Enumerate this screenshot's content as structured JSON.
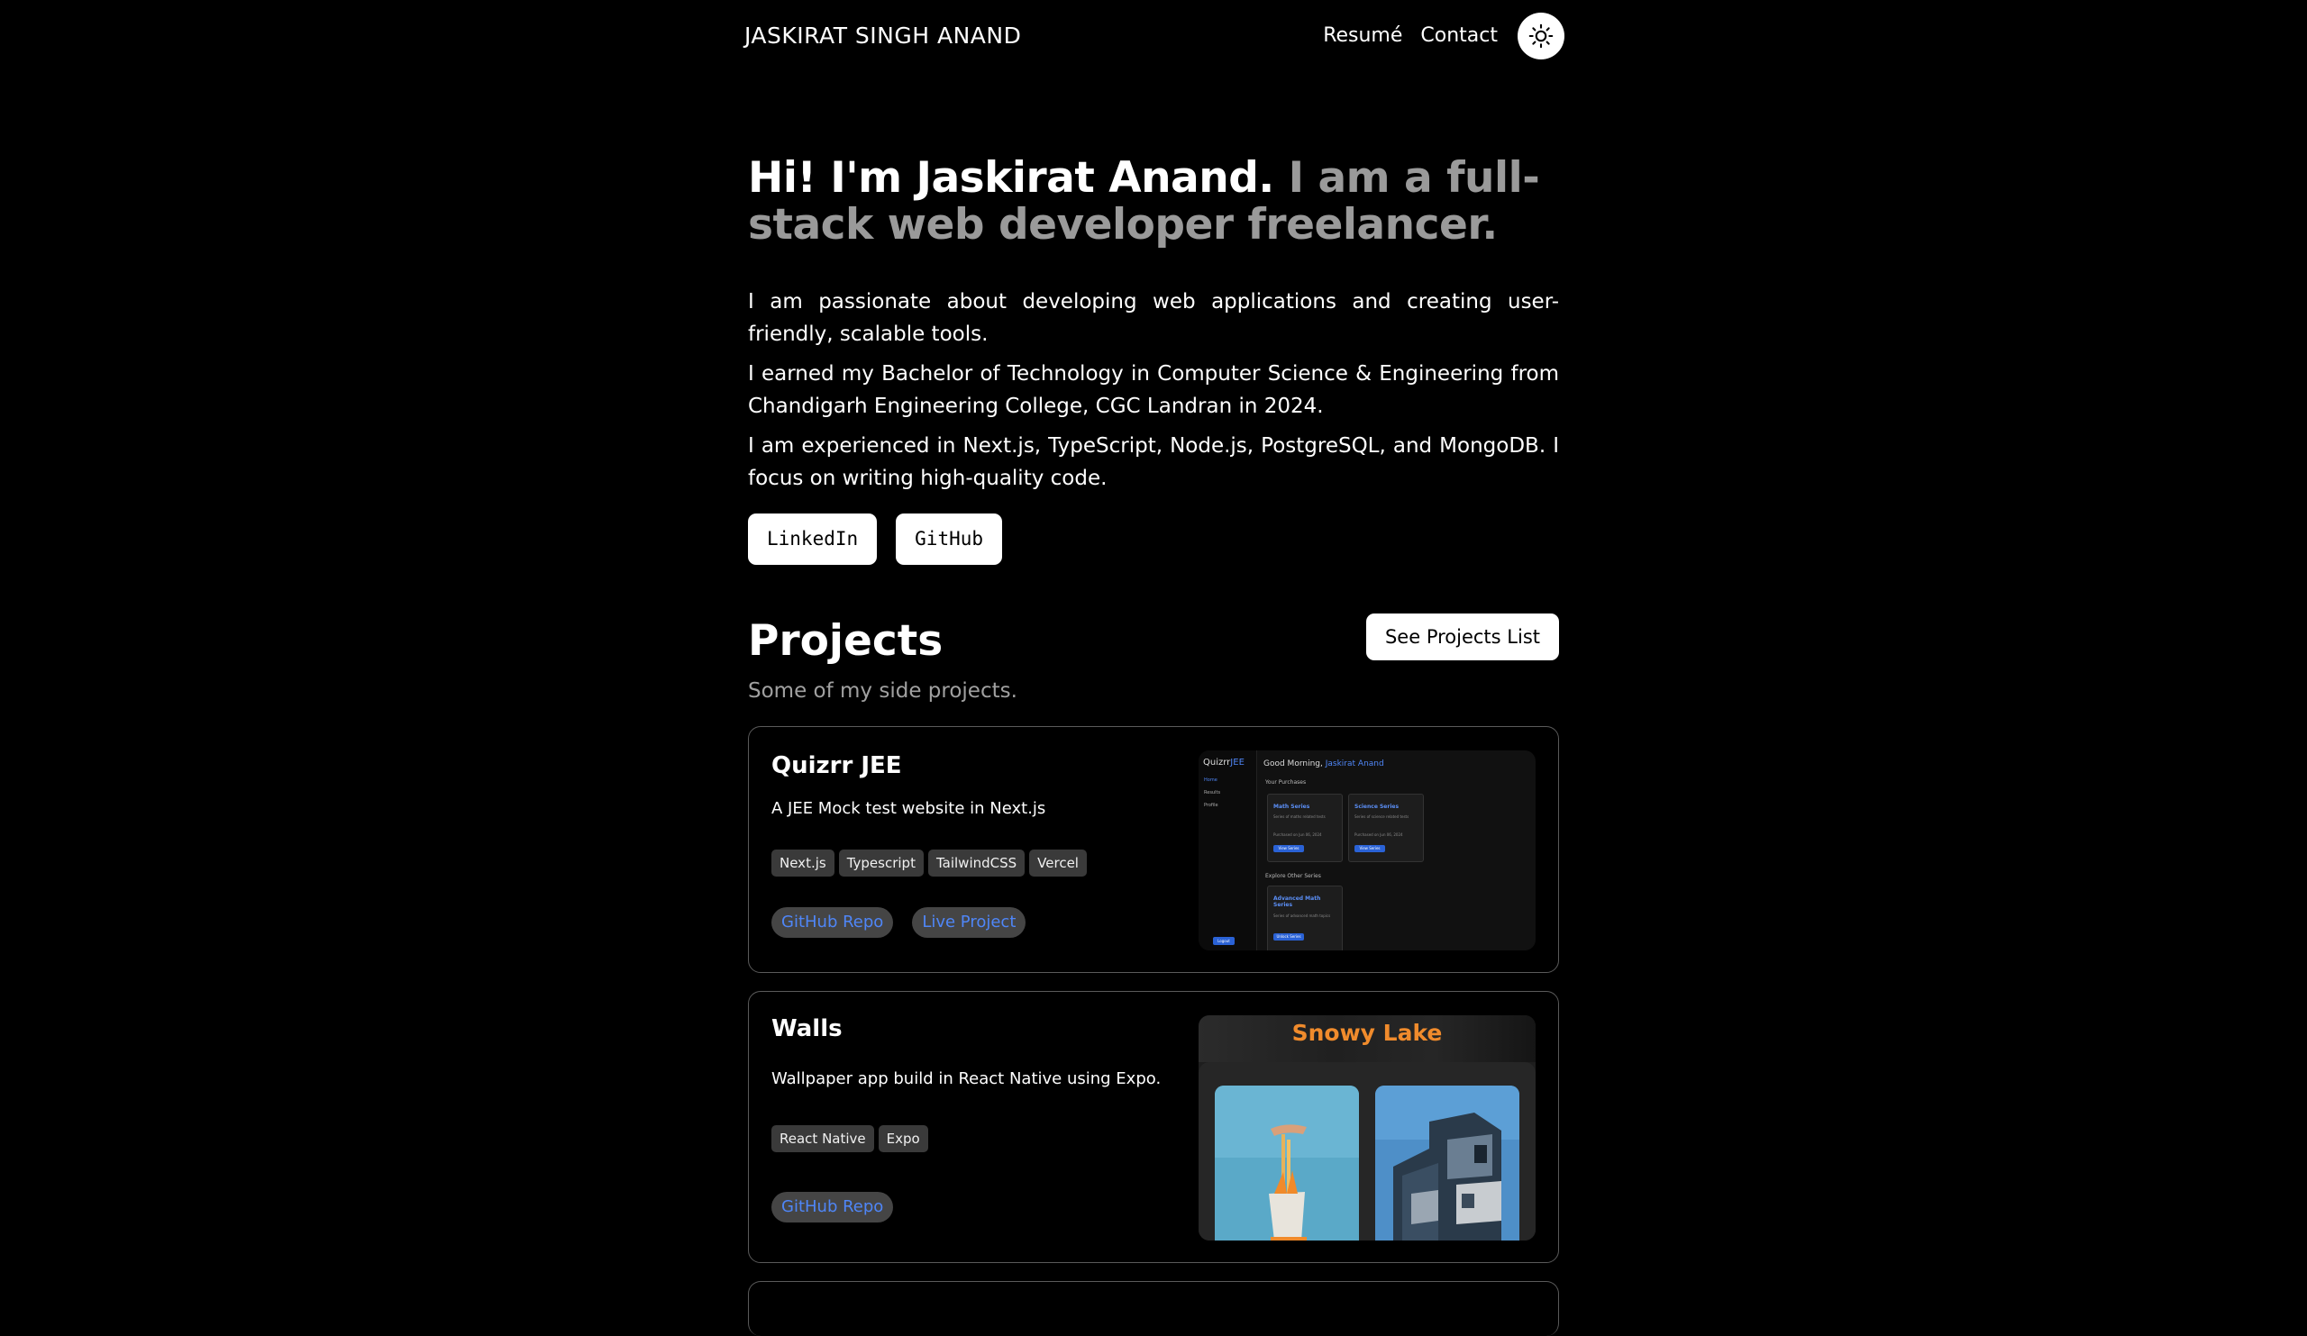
{
  "nav": {
    "brand": "JASKIRAT SINGH ANAND",
    "links": [
      "Resumé",
      "Contact"
    ],
    "theme_icon": "sun-icon"
  },
  "hero": {
    "greeting": "Hi! I'm Jaskirat Anand.",
    "tagline": "I am a full-stack web developer freelancer.",
    "paragraphs": [
      "I am passionate about developing web applications and creating user-friendly, scalable tools.",
      "I earned my Bachelor of Technology in Computer Science & Engineering from Chandigarh Engineering College, CGC Landran in 2024.",
      "I am experienced in Next.js, TypeScript, Node.js, PostgreSQL, and MongoDB. I focus on writing high-quality code."
    ],
    "social_links": [
      "LinkedIn",
      "GitHub"
    ]
  },
  "projects": {
    "title": "Projects",
    "subtitle": "Some of my side projects.",
    "see_list_label": "See Projects List",
    "items": [
      {
        "title": "Quizrr JEE",
        "description": "A JEE Mock test website in Next.js",
        "tags": [
          "Next.js",
          "Typescript",
          "TailwindCSS",
          "Vercel"
        ],
        "links": [
          "GitHub Repo",
          "Live Project"
        ],
        "preview": {
          "logo": "Quizrr",
          "logo_suffix": "JEE",
          "greeting": "Good Morning,",
          "user": "Jaskirat Anand",
          "nav": [
            "Home",
            "Results",
            "Profile"
          ],
          "logout": "Logout",
          "purchases_label": "Your Purchases",
          "purchases": [
            {
              "title": "Math Series",
              "desc": "Series of maths related tests",
              "date": "Purchased on Jun 06, 2024",
              "button": "View Series"
            },
            {
              "title": "Science Series",
              "desc": "Series of science related tests",
              "date": "Purchased on Jun 06, 2024",
              "button": "View Series"
            }
          ],
          "explore_label": "Explore Other Series",
          "explore": [
            {
              "title": "Advanced Math Series",
              "desc": "Series of advanced math topics",
              "button": "Unlock Series"
            }
          ]
        }
      },
      {
        "title": "Walls",
        "description": "Wallpaper app build in React Native using Expo.",
        "tags": [
          "React Native",
          "Expo"
        ],
        "links": [
          "GitHub Repo"
        ],
        "preview": {
          "title": "Snowy Lake"
        }
      }
    ]
  },
  "colors": {
    "background": "#000000",
    "accent_link": "#4f86f7",
    "muted_text": "#9a9a9a",
    "walls_title": "#f08b2c"
  }
}
